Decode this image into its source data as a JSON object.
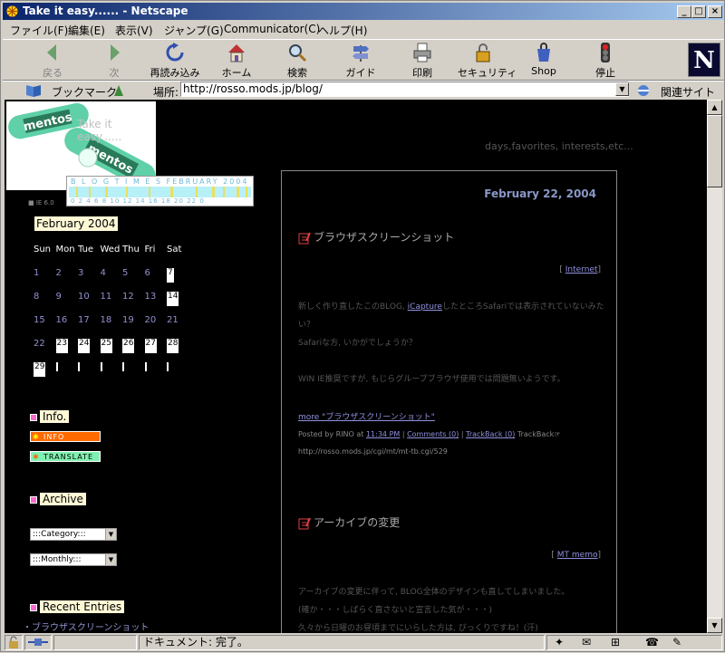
{
  "window": {
    "title": "Take it easy...... - Netscape"
  },
  "menu": [
    "ファイル(F)",
    "編集(E)",
    "表示(V)",
    "ジャンプ(G)",
    "Communicator(C)",
    "ヘルプ(H)"
  ],
  "toolbar": {
    "back": "戻る",
    "forward": "次",
    "reload": "再読み込み",
    "home": "ホーム",
    "search": "検索",
    "guide": "ガイド",
    "print": "印刷",
    "security": "セキュリティ",
    "shop": "Shop",
    "stop": "停止"
  },
  "location": {
    "bookmarks": "ブックマーク",
    "label": "場所:",
    "url": "http://rosso.mods.jp/blog/",
    "related": "関連サイト"
  },
  "status": {
    "text": "ドキュメント: 完了。"
  },
  "page": {
    "site_title": "Take it easy......",
    "logo_text": "mentos",
    "tagline": "days,favorites, interests,etc...",
    "blogtimes_title": "B L O G T I M E S    FEBRUARY 2004",
    "blogtimes_days": "0  2  4  6  8  10  12  14  16  18  20  22  0",
    "ie_version": "■ IE 6.0",
    "calendar": {
      "month": "February 2004",
      "weekdays": [
        "Sun",
        "Mon",
        "Tue",
        "Wed",
        "Thu",
        "Fri",
        "Sat"
      ],
      "rows": [
        [
          "1",
          "2",
          "3",
          "4",
          "5",
          "6",
          "7"
        ],
        [
          "8",
          "9",
          "10",
          "11",
          "12",
          "13",
          "14"
        ],
        [
          "15",
          "16",
          "17",
          "18",
          "19",
          "20",
          "21"
        ],
        [
          "22",
          "23",
          "24",
          "25",
          "26",
          "27",
          "28"
        ],
        [
          "29",
          "",
          "",
          "",
          "",
          "",
          ""
        ]
      ]
    },
    "sidebar": {
      "info_heading": "Info.",
      "info_button": "INFO",
      "translate_button": "TRANSLATE",
      "archive_heading": "Archive",
      "category_select": ":::Category:::",
      "monthly_select": ":::Monthly:::",
      "recent_heading": "Recent Entries",
      "recent_item": "・ブラウザスクリーンショット"
    },
    "date": "February 22, 2004",
    "post1": {
      "title": "ブラウザスクリーンショット",
      "category": "Internet",
      "text1a": "新しく作り直したこのBLOG, ",
      "text1_link": "iCapture",
      "text1b": "したところSafariでは表示されていないみたい？",
      "text2": "Safariな方, いかがでしょうか？",
      "text3": "WIN IE推奨ですが, もじらグループブラウザ使用では問題無いようです。",
      "more": "more \"ブラウザスクリーンショット\"",
      "posted_by": "Posted by RINO at ",
      "time": "11:34 PM",
      "comments": "Comments (0)",
      "trackback": "TrackBack (0)",
      "trackback_label": "TrackBack",
      "tb_url": "http://rosso.mods.jp/cgi/mt/mt-tb.cgi/529"
    },
    "post2": {
      "title": "アーカイブの変更",
      "category": "MT memo",
      "text1": "アーカイブの変更に伴って, BLOG全体のデザインも直してしまいました。",
      "text2": "(確か・・・しばらく直さないと宣言した気が・・・)",
      "text3": "久々から日曜のお昼頃までにいらした方は, びっくりですね！(汗)"
    }
  }
}
